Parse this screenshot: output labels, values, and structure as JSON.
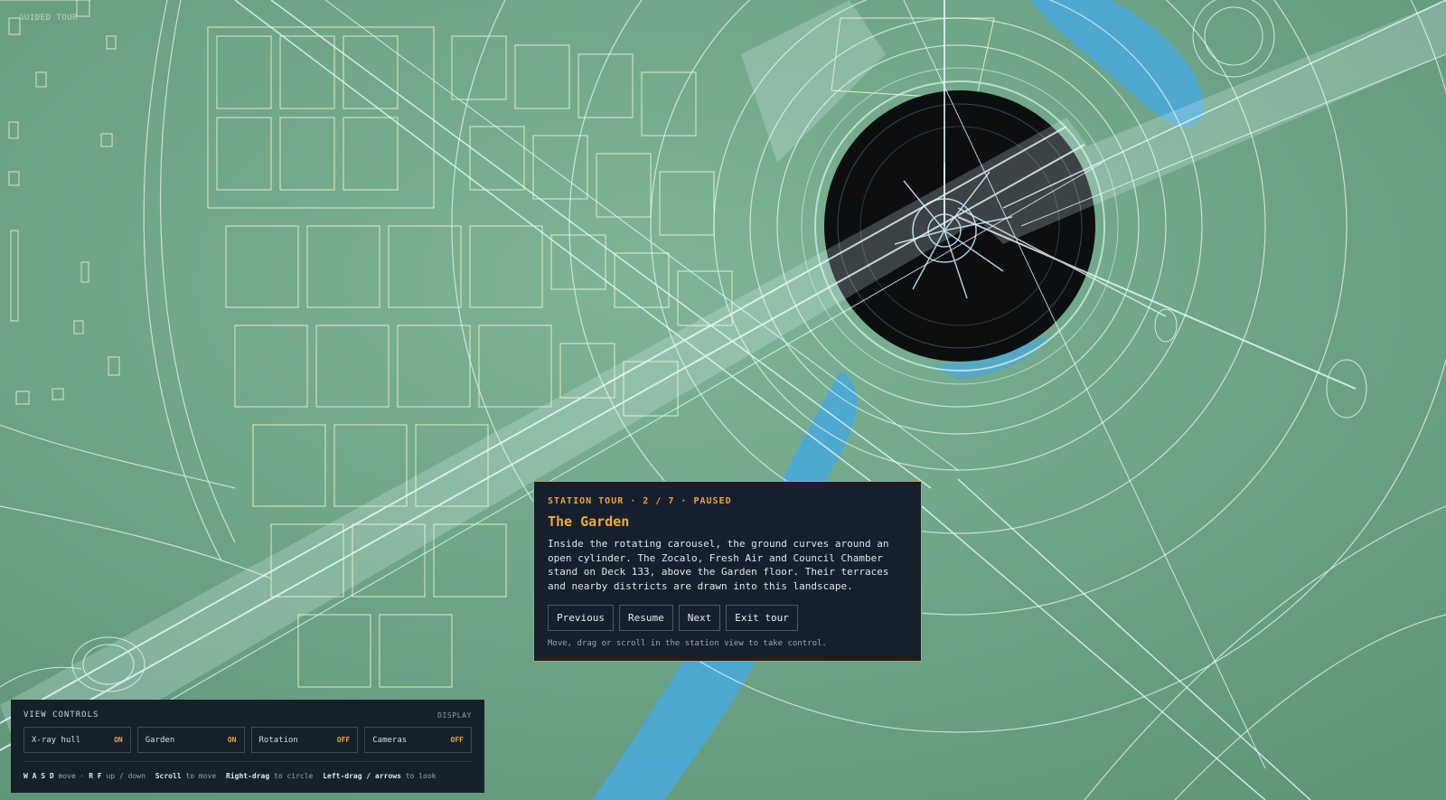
{
  "tour_label": "GUIDED TOUR",
  "tour": {
    "step_text": "STATION TOUR · 2 / 7 · PAUSED",
    "title": "The Garden",
    "description": "Inside the rotating carousel, the ground curves around an open cylinder. The Zocalo, Fresh Air and Council Chamber stand on Deck 133, above the Garden floor. Their terraces and nearby districts are drawn into this landscape.",
    "buttons": {
      "previous": "Previous",
      "resume": "Resume",
      "next": "Next",
      "exit": "Exit tour"
    },
    "hint": "Move, drag or scroll in the station view to take control."
  },
  "view_controls": {
    "title": "VIEW CONTROLS",
    "display_label": "DISPLAY",
    "toggles": [
      {
        "label": "X-ray hull",
        "state": "ON"
      },
      {
        "label": "Garden",
        "state": "ON"
      },
      {
        "label": "Rotation",
        "state": "OFF"
      },
      {
        "label": "Cameras",
        "state": "OFF"
      }
    ],
    "keys": [
      {
        "key": "W A S D",
        "action": "move"
      },
      {
        "key": "R F",
        "action": "up / down"
      },
      {
        "key": "Scroll",
        "action": "to move"
      },
      {
        "key": "Right-drag",
        "action": "to circle"
      },
      {
        "key": "Left-drag / arrows",
        "action": "to look"
      }
    ]
  },
  "colors": {
    "background": "#6fa384",
    "accent": "#e8a33d",
    "panel": "#16202c",
    "water": "#4aa8d8",
    "wire": "#dffcff"
  }
}
